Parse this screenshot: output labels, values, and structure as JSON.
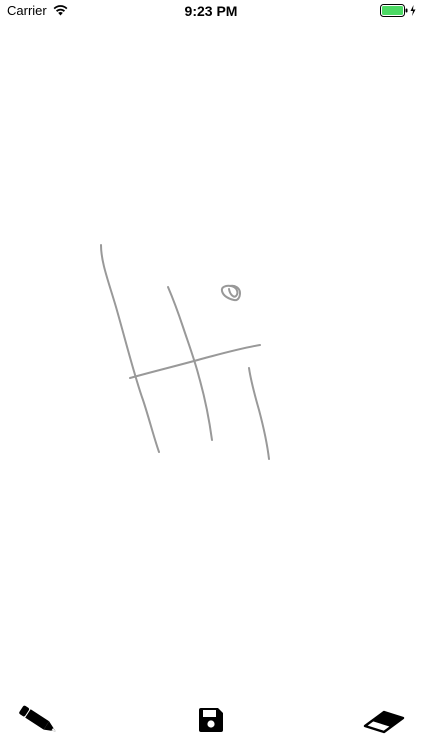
{
  "status_bar": {
    "carrier": "Carrier",
    "time": "9:23 PM",
    "battery_color": "#4cd964",
    "icons": [
      "wifi-icon",
      "battery-icon",
      "charging-icon"
    ]
  },
  "canvas": {
    "stroke_color": "#999999",
    "background": "#ffffff"
  },
  "toolbar": {
    "tools": [
      {
        "name": "pencil",
        "icon": "pencil-icon"
      },
      {
        "name": "save",
        "icon": "floppy-disk-icon"
      },
      {
        "name": "eraser",
        "icon": "eraser-icon"
      }
    ]
  }
}
